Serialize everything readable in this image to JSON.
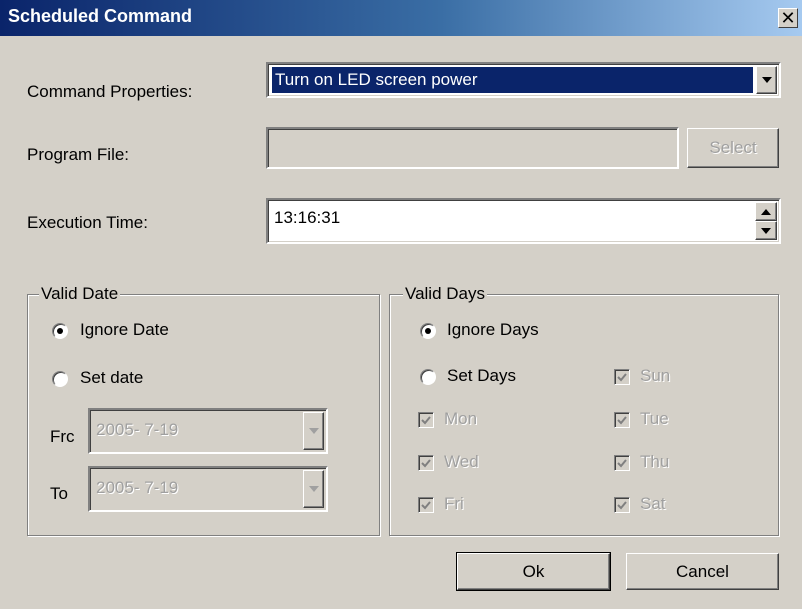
{
  "window": {
    "title": "Scheduled Command",
    "close_glyph": "✕"
  },
  "command_properties": {
    "label": "Command Properties:",
    "value": "Turn on LED screen power"
  },
  "program_file": {
    "label": "Program File:",
    "value": "",
    "select_label": "Select"
  },
  "execution_time": {
    "label": "Execution Time:",
    "value": "13:16:31"
  },
  "valid_date": {
    "title": "Valid Date",
    "ignore_label": "Ignore Date",
    "set_label": "Set date",
    "selected": "ignore",
    "from_label": "Frc",
    "from_value": "2005-  7-19",
    "to_label": "To",
    "to_value": "2005-  7-19"
  },
  "valid_days": {
    "title": "Valid Days",
    "ignore_label": "Ignore Days",
    "set_label": "Set Days",
    "selected": "ignore",
    "days": [
      {
        "label": "Sun",
        "checked": true
      },
      {
        "label": "Mon",
        "checked": true
      },
      {
        "label": "Tue",
        "checked": true
      },
      {
        "label": "Wed",
        "checked": true
      },
      {
        "label": "Thu",
        "checked": true
      },
      {
        "label": "Fri",
        "checked": true
      },
      {
        "label": "Sat",
        "checked": true
      }
    ]
  },
  "buttons": {
    "ok": "Ok",
    "cancel": "Cancel"
  }
}
